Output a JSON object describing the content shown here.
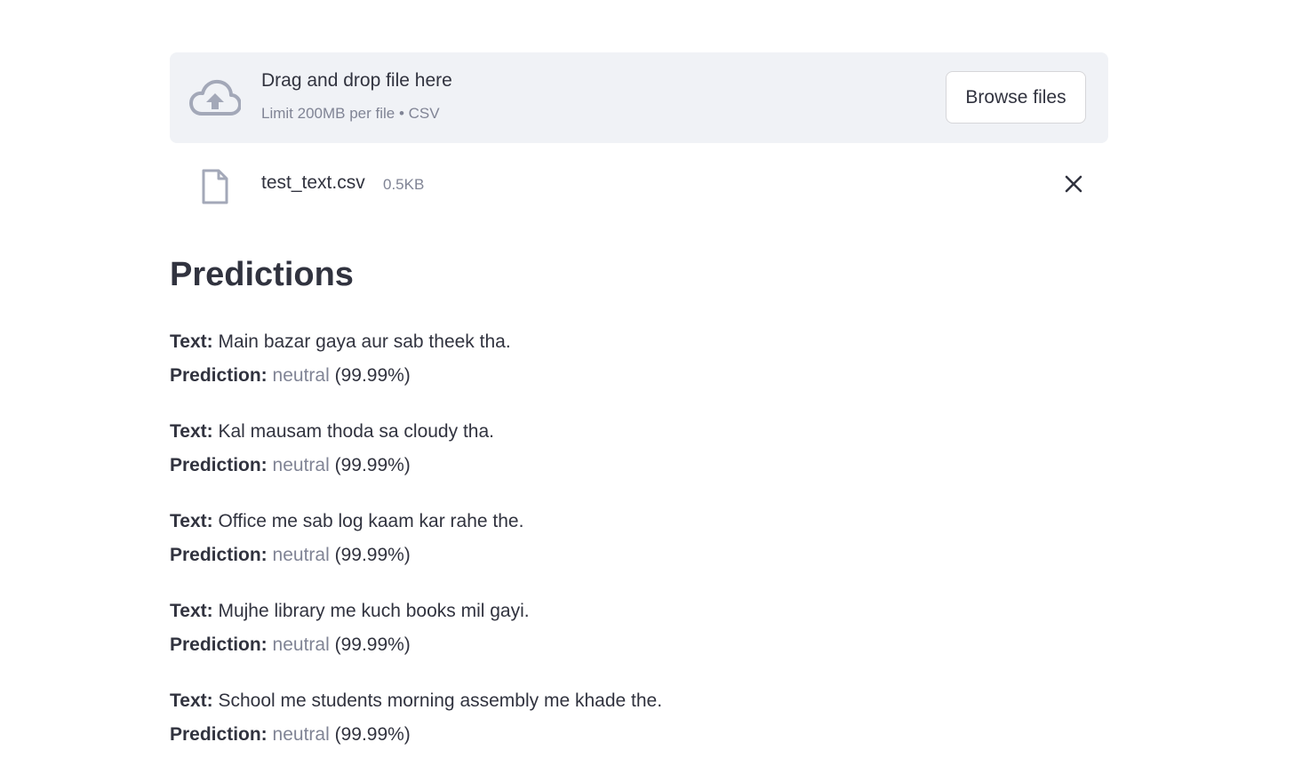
{
  "uploader": {
    "title": "Drag and drop file here",
    "limit": "Limit 200MB per file • CSV",
    "browse_label": "Browse files",
    "icon": "cloud-upload-icon"
  },
  "file": {
    "name": "test_text.csv",
    "size": "0.5KB",
    "icon": "file-icon",
    "remove_icon": "close-icon"
  },
  "heading": "Predictions",
  "labels": {
    "text": "Text:",
    "prediction": "Prediction:"
  },
  "predictions": [
    {
      "text": "Main bazar gaya aur sab theek tha.",
      "label": "neutral",
      "confidence": "(99.99%)"
    },
    {
      "text": "Kal mausam thoda sa cloudy tha.",
      "label": "neutral",
      "confidence": "(99.99%)"
    },
    {
      "text": "Office me sab log kaam kar rahe the.",
      "label": "neutral",
      "confidence": "(99.99%)"
    },
    {
      "text": "Mujhe library me kuch books mil gayi.",
      "label": "neutral",
      "confidence": "(99.99%)"
    },
    {
      "text": "School me students morning assembly me khade the.",
      "label": "neutral",
      "confidence": "(99.99%)"
    }
  ],
  "colors": {
    "text": "#31333f",
    "muted": "#808495",
    "dropzone_bg": "#f0f2f6",
    "icon": "#a3a8b8"
  }
}
